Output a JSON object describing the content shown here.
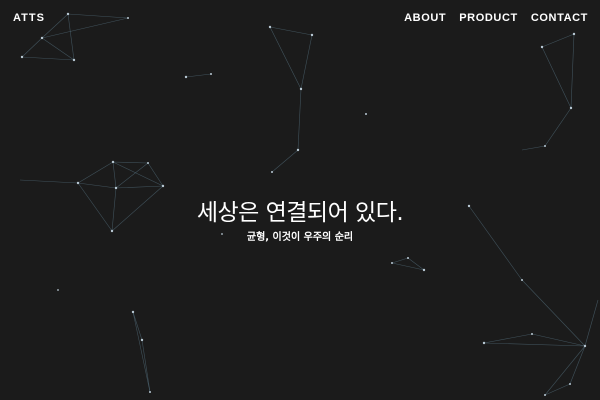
{
  "header": {
    "logo": "ATTS",
    "nav": [
      {
        "label": "ABOUT"
      },
      {
        "label": "PRODUCT"
      },
      {
        "label": "CONTACT"
      }
    ]
  },
  "hero": {
    "headline": "세상은 연결되어 있다.",
    "subheadline": "균형, 이것이 우주의 순리"
  },
  "colors": {
    "background": "#1b1b1b",
    "text": "#ffffff",
    "network_line": "#5f7f90",
    "network_node": "#b9c9d4"
  }
}
